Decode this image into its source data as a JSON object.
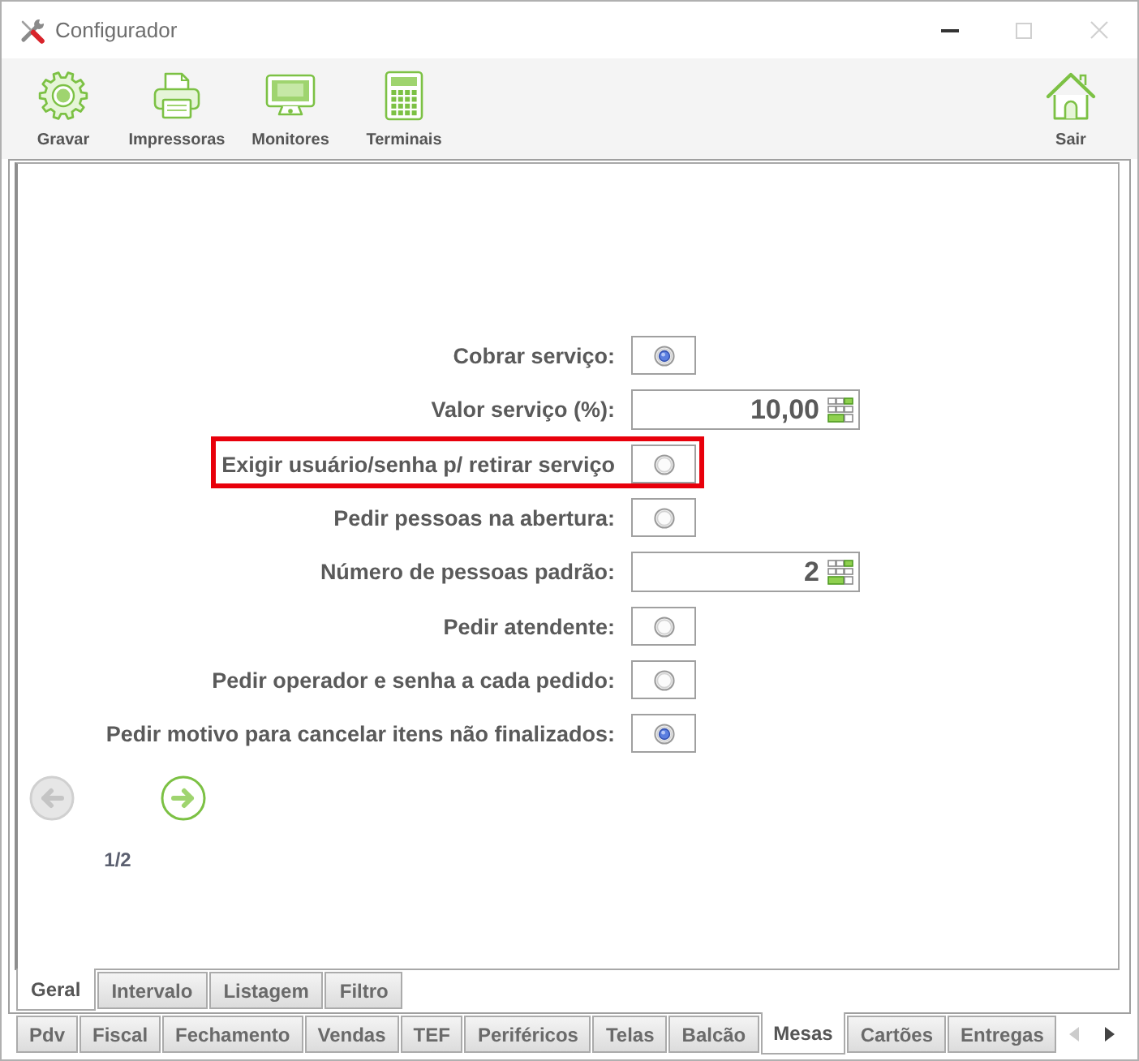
{
  "window": {
    "title": "Configurador",
    "controls": [
      {
        "kind": "minimize",
        "disabled": false
      },
      {
        "kind": "maximize",
        "disabled": true
      },
      {
        "kind": "close",
        "disabled": true
      }
    ]
  },
  "toolbar": {
    "buttons": [
      {
        "label": "Gravar",
        "kind": "gear"
      },
      {
        "label": "Impressoras",
        "kind": "printer"
      },
      {
        "label": "Monitores",
        "kind": "monitor"
      },
      {
        "label": "Terminais",
        "kind": "calculator"
      }
    ],
    "right_buttons": [
      {
        "label": "Sair",
        "kind": "house"
      }
    ]
  },
  "form": {
    "rows": [
      {
        "label": "Cobrar serviço:",
        "kind": "radio",
        "checked": true,
        "highlighted": false
      },
      {
        "label": "Valor serviço (%):",
        "kind": "number",
        "value": "10,00",
        "highlighted": false
      },
      {
        "label": "Exigir usuário/senha p/ retirar serviço",
        "kind": "radio",
        "checked": false,
        "highlighted": true
      },
      {
        "label": "Pedir pessoas na abertura:",
        "kind": "radio",
        "checked": false,
        "highlighted": false
      },
      {
        "label": "Número de pessoas padrão:",
        "kind": "number",
        "value": "2",
        "highlighted": false
      },
      {
        "label": "Pedir atendente:",
        "kind": "radio",
        "checked": false,
        "highlighted": false
      },
      {
        "label": "Pedir operador e senha a cada pedido:",
        "kind": "radio",
        "checked": false,
        "highlighted": false
      },
      {
        "label": "Pedir motivo para cancelar itens não finalizados:",
        "kind": "radio",
        "checked": true,
        "highlighted": false
      }
    ]
  },
  "pager": {
    "previous": {
      "disabled": true
    },
    "next": {
      "disabled": false
    },
    "page": "1/2"
  },
  "subtabs": [
    {
      "label": "Geral",
      "selected": true
    },
    {
      "label": "Intervalo",
      "selected": false
    },
    {
      "label": "Listagem",
      "selected": false
    },
    {
      "label": "Filtro",
      "selected": false
    }
  ],
  "tabs": [
    {
      "label": "Pdv",
      "selected": false
    },
    {
      "label": "Fiscal",
      "selected": false
    },
    {
      "label": "Fechamento",
      "selected": false
    },
    {
      "label": "Vendas",
      "selected": false
    },
    {
      "label": "TEF",
      "selected": false
    },
    {
      "label": "Periféricos",
      "selected": false
    },
    {
      "label": "Telas",
      "selected": false
    },
    {
      "label": "Balcão",
      "selected": false
    },
    {
      "label": "Mesas",
      "selected": true
    },
    {
      "label": "Cartões",
      "selected": false
    },
    {
      "label": "Entregas",
      "selected": false
    }
  ],
  "tab_scroll": {
    "left": {
      "disabled": true
    },
    "right": {
      "disabled": false
    }
  }
}
